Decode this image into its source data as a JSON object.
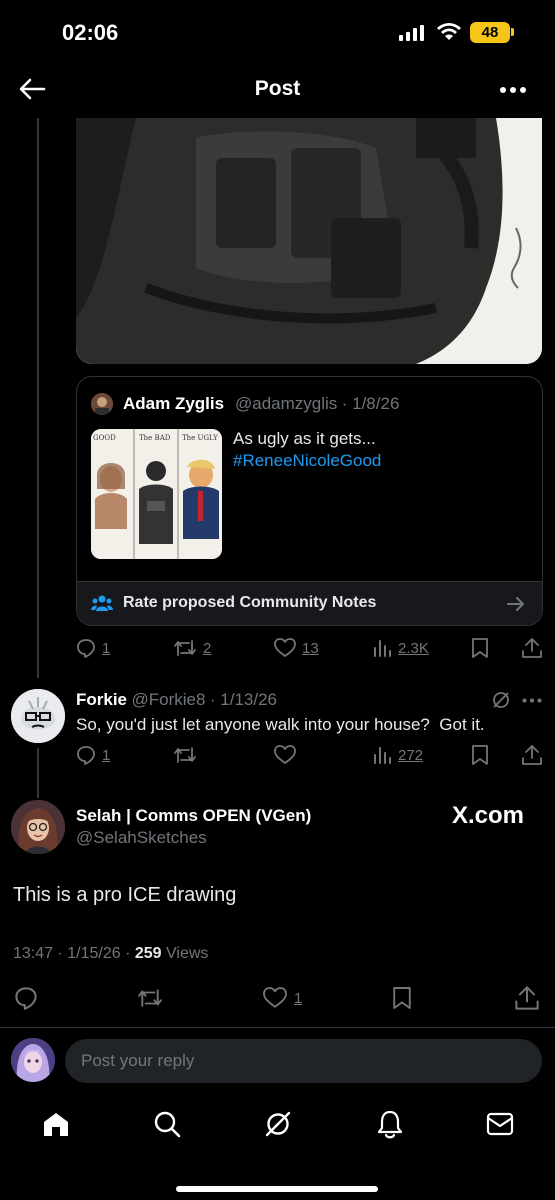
{
  "status_bar": {
    "time": "02:06",
    "battery": "48"
  },
  "nav": {
    "title": "Post"
  },
  "quoted_post": {
    "author_name": "Adam Zyglis",
    "author_handle": "@adamzyglis",
    "date": "· 1/8/26",
    "text": "As ugly as it gets...",
    "hashtag": "#ReneeNicoleGood",
    "thumbnail_labels": [
      "GOOD",
      "The BAD",
      "The UGLY"
    ],
    "community_notes_label": "Rate proposed Community Notes"
  },
  "parent_actions": {
    "replies": "1",
    "reposts": "2",
    "likes": "13",
    "views": "2.3K"
  },
  "reply": {
    "author_name": "Forkie",
    "author_handle": "@Forkie8",
    "date": "· 1/13/26",
    "text": "So, you'd just let anyone walk into your house?  Got it.",
    "actions": {
      "replies": "1",
      "reposts": "",
      "likes": "",
      "views": "272"
    }
  },
  "main_post": {
    "author_name": "Selah | Comms OPEN (VGen)",
    "author_handle": "@SelahSketches",
    "watermark": "X.com",
    "text": "This is a pro ICE drawing",
    "time": "13:47 · 1/15/26 · ",
    "views_count": "259",
    "views_label": "Views",
    "likes": "1"
  },
  "composer": {
    "placeholder": "Post your reply"
  },
  "colors": {
    "accent": "#1d9bf0",
    "battery": "#f5c518",
    "muted": "#71767b"
  }
}
